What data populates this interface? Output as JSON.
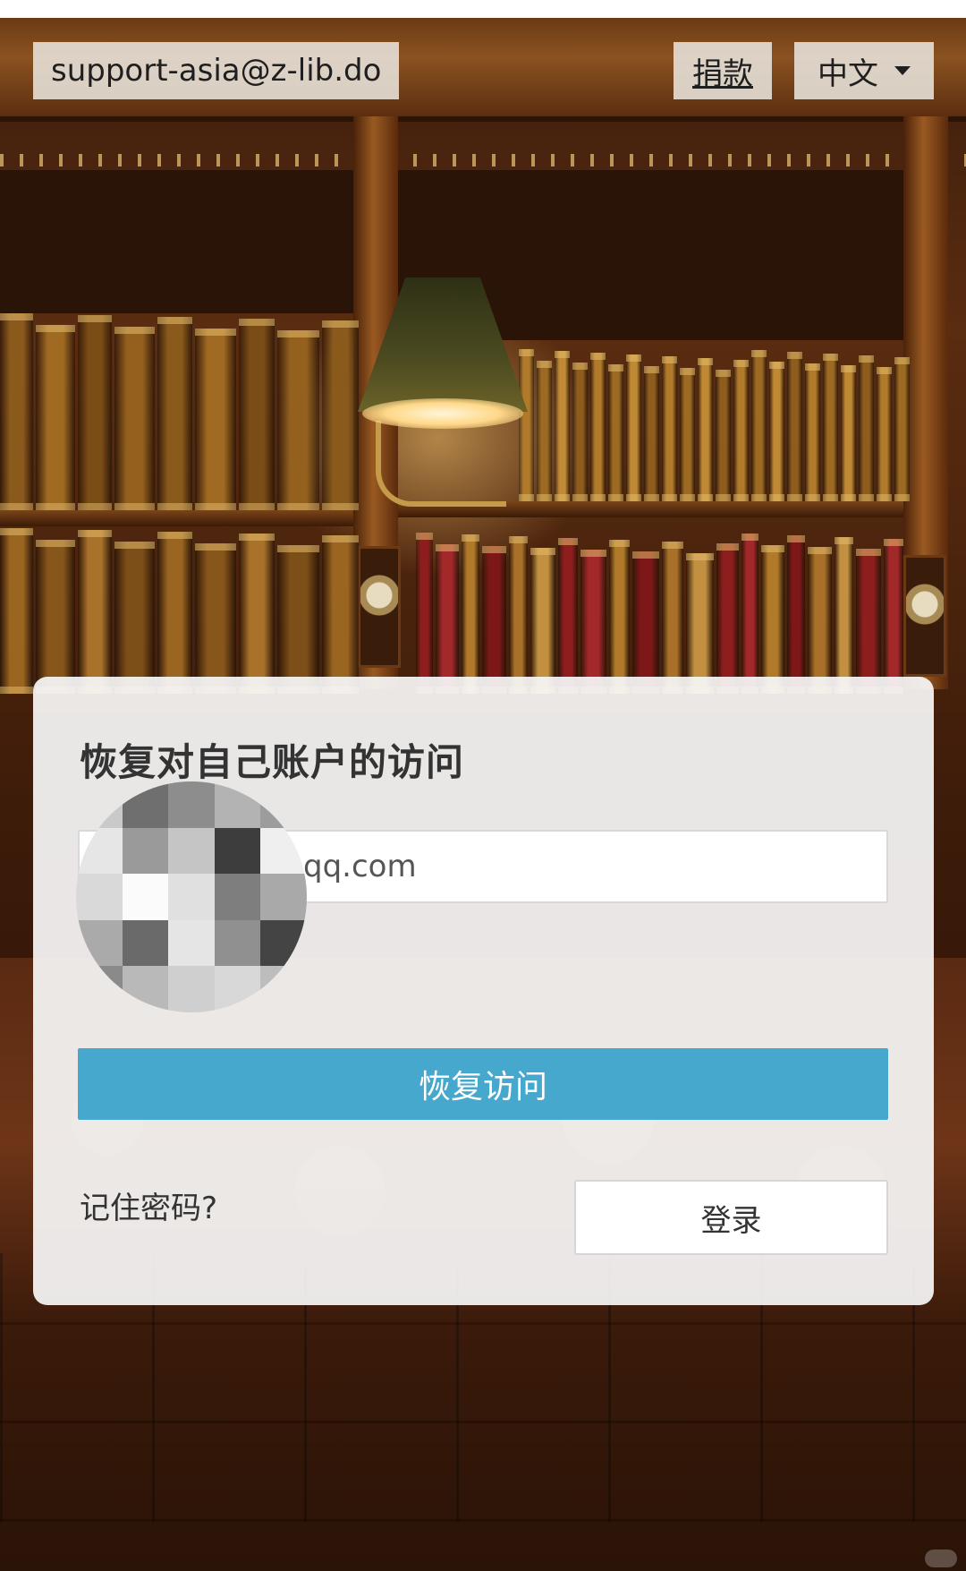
{
  "topbar": {
    "email": "support-asia@z-lib.do",
    "donate_label": "捐款",
    "language_label": "中文",
    "language_icon": "chevron-down-icon"
  },
  "card": {
    "title": "恢复对自己账户的访问",
    "email_value": "qq.com",
    "recover_label": "恢复访问",
    "remember_label": "记住密码?",
    "login_label": "登录"
  },
  "colors": {
    "primary_button": "#47a8cd",
    "card_background": "#f6f6f6",
    "text": "#333333"
  },
  "avatar_pixels": [
    "#c9c9c9",
    "#6f6f6f",
    "#8d8d8d",
    "#b3b3b3",
    "#9c9c9c",
    "#e6e6e6",
    "#9a9a9a",
    "#c5c5c5",
    "#3d3d3d",
    "#efefef",
    "#d9d9d9",
    "#fbfbfb",
    "#e0e0e0",
    "#7e7e7e",
    "#a9a9a9",
    "#aaaaaa",
    "#6a6a6a",
    "#e5e5e5",
    "#909090",
    "#444444",
    "#8a8a8a",
    "#b9b9b9",
    "#cfcfcf",
    "#d8d8d8",
    "#bdbdbd"
  ]
}
